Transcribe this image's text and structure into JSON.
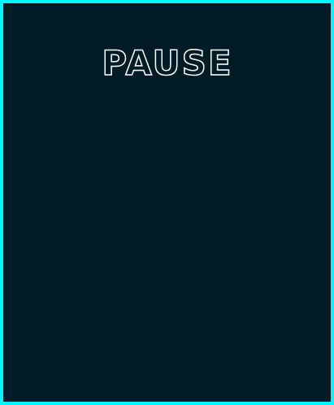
{
  "screen": {
    "title": "PAUSE",
    "border_color": "#00f7ff",
    "background_color": "#011c27",
    "title_color": "#ffffff"
  }
}
